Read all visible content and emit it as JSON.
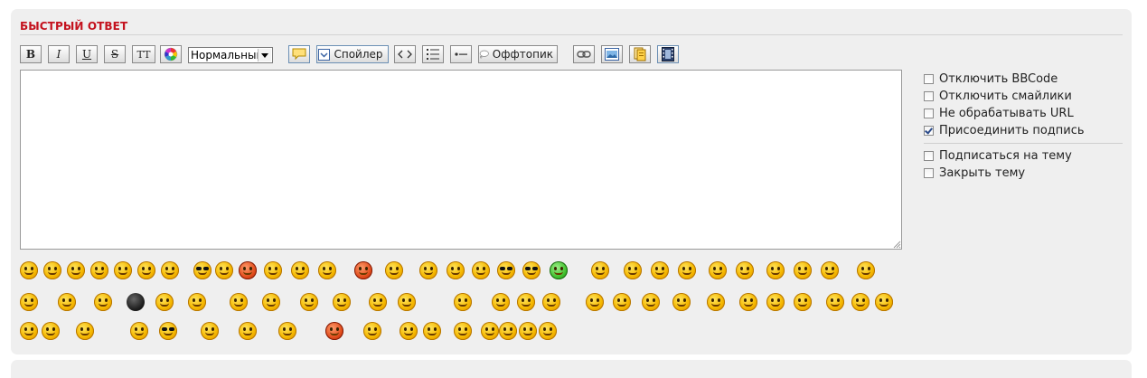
{
  "quick_reply": {
    "title": "БЫСТРЫЙ ОТВЕТ"
  },
  "toolbar": {
    "bold": "B",
    "italic": "I",
    "underline": "U",
    "strike": "S",
    "typewriter": "TT",
    "font_size_value": "Нормальный",
    "spoiler_label": "Спойлер",
    "offtopic_label": "Оффтопик"
  },
  "editor": {
    "value": ""
  },
  "options": {
    "disable_bbcode": "Отключить BBCode",
    "disable_smilies": "Отключить смайлики",
    "no_url_parse": "Не обрабатывать URL",
    "attach_signature": "Присоединить подпись",
    "subscribe_topic": "Подписаться на тему",
    "lock_topic": "Закрыть тему"
  },
  "options_state": {
    "disable_bbcode": false,
    "disable_smilies": false,
    "no_url_parse": false,
    "attach_signature": true,
    "subscribe_topic": false,
    "lock_topic": false
  },
  "smilies": {
    "row1_count": 31,
    "row2_count": 28,
    "row3_count": 17
  },
  "colors": {
    "title": "#c4121e",
    "panel_bg": "#efefef",
    "button_border": "#8a8a8a"
  }
}
